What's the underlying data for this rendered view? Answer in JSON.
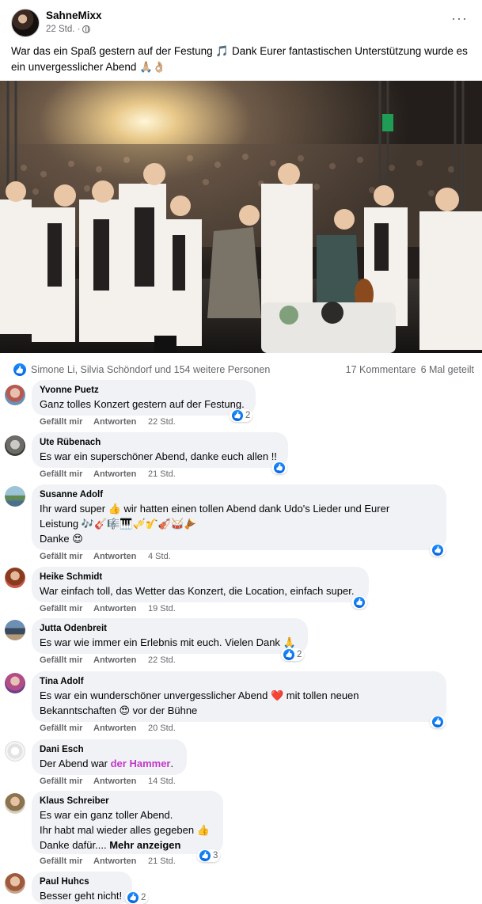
{
  "post": {
    "author": "SahneMixx",
    "time": "22 Std. ·",
    "more": "···",
    "text": "War das ein Spaß gestern auf der Festung 🎵  Dank Eurer fantastischen Unterstützung wurde es ein unvergesslicher Abend 🙏🏼👌🏼"
  },
  "reactions": {
    "reactors": "Simone Li, Silvia Schöndorf und 154 weitere Personen",
    "comments_count": "17 Kommentare",
    "shares_count": "6 Mal geteilt"
  },
  "actions": {
    "like": "Gefällt mir",
    "reply": "Antworten"
  },
  "comments": [
    {
      "name": "Yvonne Puetz",
      "text": "Ganz tolles Konzert gestern auf der Festung.",
      "time": "22 Std.",
      "likes": "2"
    },
    {
      "name": "Ute Rübenach",
      "text": "Es war ein superschöner Abend, danke euch allen !!",
      "time": "21 Std.",
      "likes": ""
    },
    {
      "name": "Susanne Adolf",
      "text_lines": [
        "Ihr ward super 👍 wir hatten einen tollen Abend dank Udo's Lieder und Eurer",
        "Leistung 🎶🎸🎼🎹🎺🎷🎻🥁🪘",
        "Danke 😍"
      ],
      "time": "4 Std.",
      "likes": ""
    },
    {
      "name": "Heike Schmidt",
      "text": "War einfach toll, das Wetter das Konzert, die Location, einfach super.",
      "time": "19 Std.",
      "likes": ""
    },
    {
      "name": "Jutta Odenbreit",
      "text": "Es war wie immer ein Erlebnis mit euch. Vielen Dank 🙏",
      "time": "22 Std.",
      "likes": "2"
    },
    {
      "name": "Tina Adolf",
      "text_lines": [
        "Es war ein wunderschöner unvergesslicher Abend ❤️ mit tollen neuen",
        "Bekanntschaften 😍 vor der Bühne"
      ],
      "time": "20 Std.",
      "likes": ""
    },
    {
      "name": "Dani Esch",
      "text_pre": "Der Abend war ",
      "text_hl": "der Hammer",
      "text_post": ".",
      "time": "14 Std.",
      "likes": ""
    },
    {
      "name": "Klaus Schreiber",
      "text_lines": [
        "Es war ein ganz toller Abend.",
        "Ihr habt mal wieder alles gegeben 👍",
        "Danke dafür...."
      ],
      "more": "Mehr anzeigen",
      "time": "21 Std.",
      "likes": "3"
    },
    {
      "name": "Paul Huhcs",
      "text": "Besser geht nicht!",
      "likes": "2"
    }
  ],
  "icons": {
    "post_more": "more-icon",
    "privacy": "globe-icon",
    "reaction": "like-reaction-icon"
  }
}
